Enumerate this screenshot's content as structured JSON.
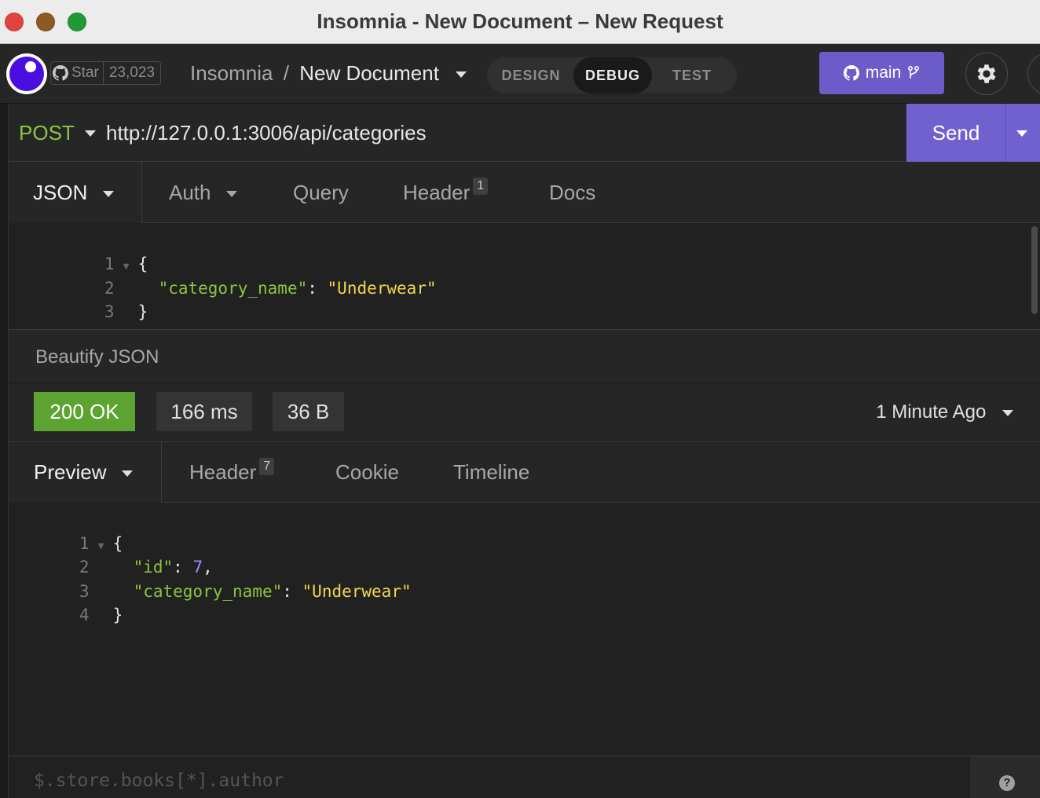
{
  "window": {
    "title": "Insomnia - New Document – New Request"
  },
  "header": {
    "github": {
      "star_label": "Star",
      "star_count": "23,023"
    },
    "breadcrumb": {
      "root": "Insomnia",
      "separator": "/",
      "document": "New Document"
    },
    "modes": [
      {
        "label": "DESIGN",
        "active": false
      },
      {
        "label": "DEBUG",
        "active": true
      },
      {
        "label": "TEST",
        "active": false
      }
    ],
    "branch": {
      "label": "main"
    }
  },
  "request": {
    "method": "POST",
    "url": "http://127.0.0.1:3006/api/categories",
    "send_label": "Send",
    "tabs": {
      "body": "JSON",
      "auth": "Auth",
      "query": "Query",
      "header": "Header",
      "header_count": "1",
      "docs": "Docs"
    },
    "body_lines": [
      {
        "n": "1",
        "text": "{"
      },
      {
        "n": "2",
        "key": "\"category_name\"",
        "sep": ": ",
        "value": "\"Underwear\""
      },
      {
        "n": "3",
        "text": "}"
      }
    ],
    "beautify_label": "Beautify JSON"
  },
  "response": {
    "status": "200 OK",
    "status_color": "#5da331",
    "time": "166 ms",
    "size": "36 B",
    "when": "1 Minute Ago",
    "tabs": {
      "preview": "Preview",
      "header": "Header",
      "header_count": "7",
      "cookie": "Cookie",
      "timeline": "Timeline"
    },
    "body_lines": [
      {
        "n": "1",
        "text": "{"
      },
      {
        "n": "2",
        "key": "\"id\"",
        "sep": ": ",
        "value": "7",
        "trail": ","
      },
      {
        "n": "3",
        "key": "\"category_name\"",
        "sep": ": ",
        "value": "\"Underwear\""
      },
      {
        "n": "4",
        "text": "}"
      }
    ],
    "filter_placeholder": "$.store.books[*].author"
  }
}
